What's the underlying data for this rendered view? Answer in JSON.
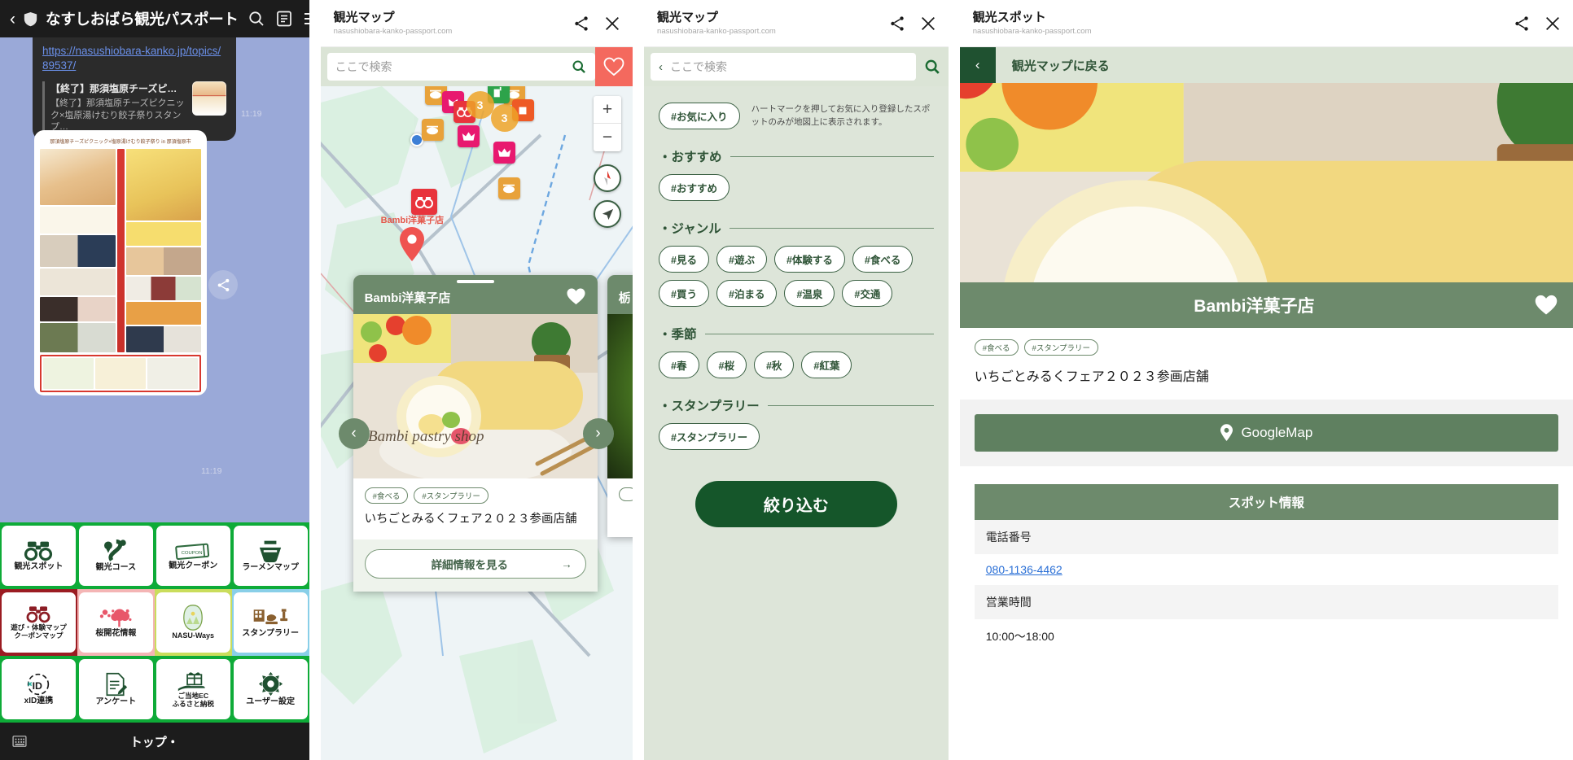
{
  "panel_line": {
    "nav": {
      "back_icon": "chevron-left-icon",
      "shield_icon": "shield-icon",
      "title": "なすしおばら観光パスポート",
      "search_icon": "search-icon",
      "list_icon": "list-icon",
      "menu_icon": "hamburger-menu-icon"
    },
    "message": {
      "url": "https://nasushiobara-kanko.jp/topics/89537/",
      "card_title": "【終了】那須塩原チーズピクニッ…",
      "card_desc": "【終了】那須塩原チーズピクニック×塩原湯けむり餃子祭りスタンプ…",
      "timestamp_1": "11:19",
      "timestamp_2": "11:19",
      "poster_heading": "那須塩原チーズピクニック×塩原湯けむり餃子祭り in 那須塩原市"
    },
    "share_icon": "share-icon",
    "richmenu": [
      {
        "label": "観光スポット",
        "icon": "binoculars-icon",
        "color": "#0eab38",
        "icon_color": "#1f5130"
      },
      {
        "label": "観光コース",
        "icon": "route-pin-icon",
        "color": "#0eab38",
        "icon_color": "#1f5130"
      },
      {
        "label": "観光クーポン",
        "icon": "coupon-icon",
        "color": "#0eab38",
        "icon_color": "#2f6b3f"
      },
      {
        "label": "ラーメンマップ",
        "icon": "ramen-bowl-icon",
        "color": "#0eab38",
        "icon_color": "#1f5130"
      },
      {
        "label": "遊び・体験マップ\nクーポンマップ",
        "icon": "binoculars-icon",
        "color": "#9b1c22",
        "icon_color": "#8c1d25"
      },
      {
        "label": "桜開花情報",
        "icon": "cherry-blossom-icon",
        "color": "#f4b5b5",
        "icon_color": "#e8576a"
      },
      {
        "label": "NASU-Ways",
        "icon": "nasu-ways-logo",
        "color": "#cadd5c",
        "icon_color": "#7aa34a"
      },
      {
        "label": "スタンプラリー",
        "icon": "stamp-icon",
        "color": "#89cfe8",
        "icon_color": "#8a6030"
      },
      {
        "label": "xID連携",
        "icon": "xid-icon",
        "color": "#0eab38",
        "icon_color": "#1a1a1a"
      },
      {
        "label": "アンケート",
        "icon": "survey-icon",
        "color": "#0eab38",
        "icon_color": "#1f5130"
      },
      {
        "label": "ご当地EC\nふるさと納税",
        "icon": "gift-hand-icon",
        "color": "#0eab38",
        "icon_color": "#1f5130"
      },
      {
        "label": "ユーザー設定",
        "icon": "gear-icon",
        "color": "#0eab38",
        "icon_color": "#1f5130"
      }
    ],
    "bottom": {
      "keyboard_icon": "keyboard-icon",
      "label": "トップ・"
    }
  },
  "panel_map": {
    "chrome": {
      "title": "観光マップ",
      "url": "nasushiobara-kanko-passport.com",
      "share_icon": "share-icon",
      "close_icon": "close-icon"
    },
    "search": {
      "placeholder": "ここで検索",
      "search_icon": "search-icon"
    },
    "favorite_icon": "heart-outline-icon",
    "controls": {
      "zoom_in": "+",
      "zoom_out": "−",
      "compass_icon": "compass-icon",
      "locate_icon": "locate-arrow-icon"
    },
    "map_labels": [
      "Bambi洋菓子店"
    ],
    "clusters": [
      "3",
      "3"
    ],
    "card": {
      "name": "Bambi洋菓子店",
      "favorite_icon": "heart-filled-icon",
      "tags": [
        "#食べる",
        "#スタンプラリー"
      ],
      "title": "いちごとみるくフェア２０２３参画店舗",
      "detail_label": "詳細情報を見る",
      "detail_arrow": "arrow-right-icon"
    },
    "card_next": {
      "name": "栃"
    },
    "prev_arrow": "chevron-left-icon",
    "next_arrow": "chevron-right-icon"
  },
  "panel_filter": {
    "chrome": {
      "title": "観光マップ",
      "url": "nasushiobara-kanko-passport.com",
      "share_icon": "share-icon",
      "close_icon": "close-icon"
    },
    "search": {
      "placeholder": "ここで検索",
      "back_icon": "chevron-left-icon",
      "search_icon": "search-icon"
    },
    "favorite": {
      "pill": "#お気に入り",
      "note": "ハートマークを押してお気に入り登録したスポットのみが地図上に表示されます。"
    },
    "sections": [
      {
        "title": "・おすすめ",
        "tags": [
          "#おすすめ"
        ]
      },
      {
        "title": "・ジャンル",
        "tags": [
          "#見る",
          "#遊ぶ",
          "#体験する",
          "#食べる",
          "#買う",
          "#泊まる",
          "#温泉",
          "#交通"
        ]
      },
      {
        "title": "・季節",
        "tags": [
          "#春",
          "#桜",
          "#秋",
          "#紅葉"
        ]
      },
      {
        "title": "・スタンプラリー",
        "tags": [
          "#スタンプラリー"
        ]
      }
    ],
    "apply_label": "絞り込む"
  },
  "panel_detail": {
    "chrome": {
      "title": "観光スポット",
      "url": "nasushiobara-kanko-passport.com",
      "share_icon": "share-icon",
      "close_icon": "close-icon"
    },
    "back": {
      "icon": "chevron-left-icon",
      "label": "観光マップに戻る"
    },
    "spot": {
      "name": "Bambi洋菓子店",
      "favorite_icon": "heart-filled-icon",
      "tags": [
        "#食べる",
        "#スタンプラリー"
      ],
      "subtitle": "いちごとみるくフェア２０２３参画店舗"
    },
    "gmap": {
      "label": "GoogleMap",
      "pin_icon": "map-pin-icon"
    },
    "info": {
      "header": "スポット情報",
      "rows": [
        {
          "label": "電話番号",
          "value": "080-1136-4462",
          "is_link": true
        },
        {
          "label": "営業時間",
          "value": "10:00〜18:00",
          "is_link": false
        }
      ]
    }
  },
  "colors": {
    "line_nav_bg": "#1c1c1c",
    "line_chat_bg": "#9aa9d8",
    "richmenu_green": "#0eab38",
    "brand_green": "#1f5130",
    "sage": "#6d8a6c",
    "pale_sage": "#dde5d9",
    "search_bar": "#dbe4d6",
    "favorite_red": "#f4695e",
    "apply_green": "#15562a",
    "link_blue": "#2a6fd6"
  }
}
